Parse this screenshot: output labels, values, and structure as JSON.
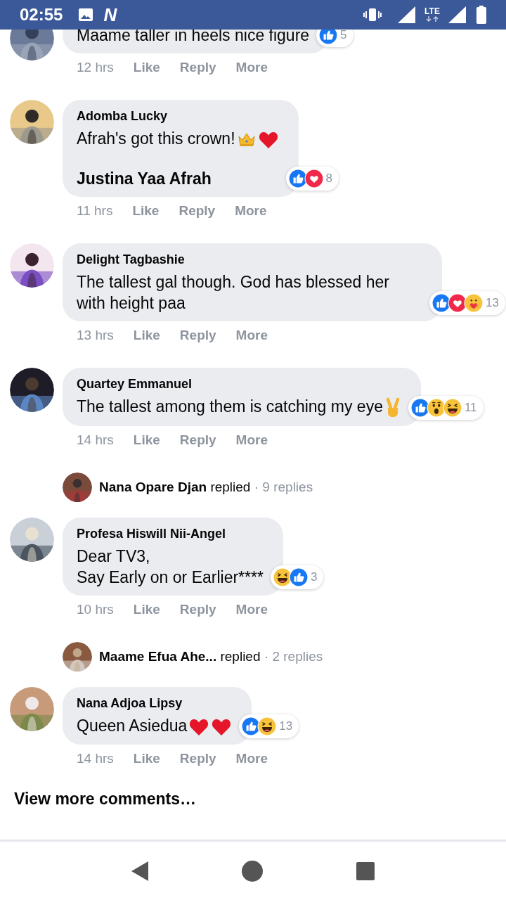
{
  "status_bar": {
    "time": "02:55",
    "app_logo": "N",
    "network": "LTE"
  },
  "items": [
    {
      "kind": "comment",
      "lines": [
        "Maame taller in heels nice figure"
      ],
      "reactions": [
        {
          "kind": "like"
        }
      ],
      "reaction_count": "5",
      "time": "12 hrs",
      "actions": [
        "Like",
        "Reply",
        "More"
      ]
    },
    {
      "kind": "comment",
      "author": "Adomba Lucky",
      "lines": [
        "Afrah's got this crown!"
      ],
      "emoji": [
        {
          "kind": "crown"
        },
        {
          "kind": "heart"
        }
      ],
      "mention": "Justina Yaa Afrah",
      "reactions": [
        {
          "kind": "like"
        },
        {
          "kind": "love"
        }
      ],
      "reaction_count": "8",
      "time": "11 hrs",
      "actions": [
        "Like",
        "Reply",
        "More"
      ]
    },
    {
      "kind": "comment",
      "author": "Delight Tagbashie",
      "lines": [
        "The tallest gal though. God has blessed her with height paa"
      ],
      "reactions": [
        {
          "kind": "like"
        },
        {
          "kind": "love"
        },
        {
          "kind": "care"
        }
      ],
      "reaction_count": "13",
      "time": "13 hrs",
      "actions": [
        "Like",
        "Reply",
        "More"
      ]
    },
    {
      "kind": "comment",
      "author": "Quartey Emmanuel",
      "lines": [
        "The tallest among them is catching my eye"
      ],
      "emoji": [
        {
          "kind": "victory"
        }
      ],
      "reactions": [
        {
          "kind": "like"
        },
        {
          "kind": "wow"
        },
        {
          "kind": "haha"
        }
      ],
      "reaction_count": "11",
      "time": "14 hrs",
      "actions": [
        "Like",
        "Reply",
        "More"
      ]
    },
    {
      "kind": "replies",
      "author": "Nana Opare Djan",
      "verb": "replied",
      "count": "· 9 replies"
    },
    {
      "kind": "comment",
      "author": "Profesa Hiswill Nii-Angel",
      "lines": [
        "Dear TV3,",
        "Say Early on or Earlier****"
      ],
      "reactions": [
        {
          "kind": "haha"
        },
        {
          "kind": "like"
        }
      ],
      "reaction_count": "3",
      "time": "10 hrs",
      "actions": [
        "Like",
        "Reply",
        "More"
      ]
    },
    {
      "kind": "replies",
      "author": "Maame Efua Ahe...",
      "verb": "replied",
      "count": "· 2 replies"
    },
    {
      "kind": "comment",
      "author": "Nana Adjoa Lipsy",
      "lines": [
        "Queen Asiedua"
      ],
      "emoji": [
        {
          "kind": "heart"
        },
        {
          "kind": "heart"
        }
      ],
      "reactions": [
        {
          "kind": "like"
        },
        {
          "kind": "haha"
        }
      ],
      "reaction_count": "13",
      "time": "14 hrs",
      "actions": [
        "Like",
        "Reply",
        "More"
      ]
    }
  ],
  "view_more": "View more comments…"
}
